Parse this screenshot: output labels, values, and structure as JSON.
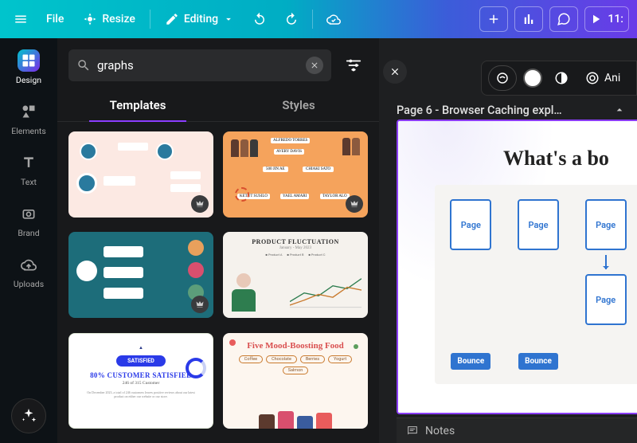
{
  "topbar": {
    "file": "File",
    "resize": "Resize",
    "editing": "Editing",
    "timer": "11:"
  },
  "nav": {
    "design": "Design",
    "elements": "Elements",
    "text": "Text",
    "brand": "Brand",
    "uploads": "Uploads"
  },
  "search": {
    "value": "graphs"
  },
  "tabs": {
    "templates": "Templates",
    "styles": "Styles"
  },
  "templates": [
    {
      "id": "t1",
      "labels": [
        "ALFREDO TORRES",
        "AVERY DAVIS",
        "500 JIN AE",
        "CHIAKI SATO",
        "KETUT SUSILO",
        "YAEL AMARI",
        "TAYLOR ALO"
      ]
    },
    {
      "id": "t2"
    },
    {
      "id": "t3"
    },
    {
      "id": "t4",
      "title": "PRODUCT FLUCTUATION",
      "subtitle": "January - May 2023",
      "legend": [
        "Product A",
        "Product B",
        "Product C"
      ]
    },
    {
      "id": "t5",
      "badge": "SATISFIED",
      "headline": "80% CUSTOMER SATISFIED",
      "sub": "246 of 315 Customer",
      "fine": "On December 2023, a total of 246 customers leaves positive reviews about our latest product on either our website or our store."
    },
    {
      "id": "t6",
      "title": "Five Mood-Boosting Food",
      "chips": [
        "Coffee",
        "Chocolate",
        "Berries",
        "Yogurt",
        "Salmon"
      ]
    }
  ],
  "page": {
    "label": "Page 6 - Browser Caching expl…",
    "title": "What's a bo",
    "pageWord": "Page",
    "bounce": "Bounce"
  },
  "float": {
    "animate": "Ani"
  },
  "notes": "Notes"
}
